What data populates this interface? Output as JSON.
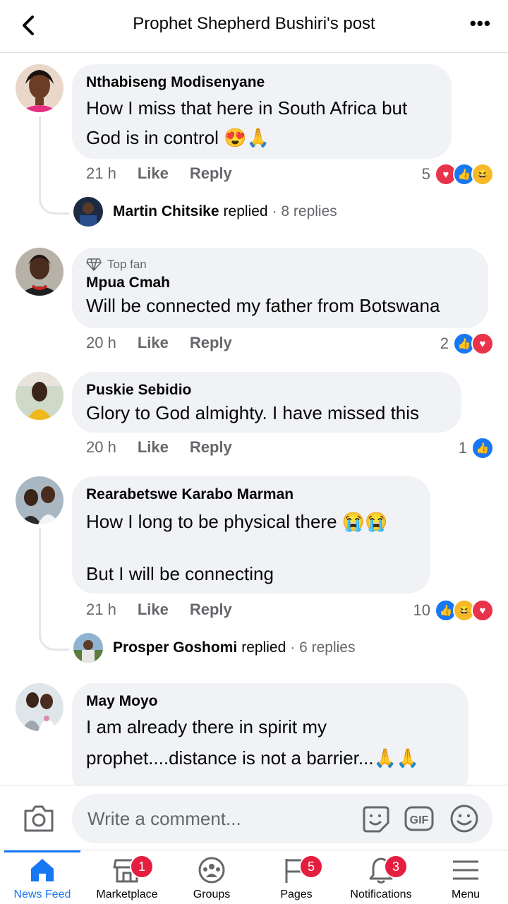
{
  "header": {
    "title": "Prophet Shepherd Bushiri's post"
  },
  "comments": [
    {
      "author": "Nthabiseng Modisenyane",
      "lines": [
        "How I miss that here in South Africa but",
        "God is in control 😍🙏"
      ],
      "time": "21 h",
      "like": "Like",
      "reply": "Reply",
      "reaction_count": "5",
      "reactions": [
        "love",
        "like",
        "haha"
      ],
      "replied_by": "Martin Chitsike",
      "replied_text": "replied",
      "replies": "· 8 replies"
    },
    {
      "badge": "Top fan",
      "author": "Mpua Cmah",
      "lines": [
        "Will be connected my father from Botswana"
      ],
      "time": "20 h",
      "like": "Like",
      "reply": "Reply",
      "reaction_count": "2",
      "reactions": [
        "like",
        "love"
      ]
    },
    {
      "author": "Puskie Sebidio",
      "lines": [
        "Glory to God almighty. I have missed this"
      ],
      "time": "20 h",
      "like": "Like",
      "reply": "Reply",
      "reaction_count": "1",
      "reactions": [
        "like"
      ]
    },
    {
      "author": "Rearabetswe Karabo Marman",
      "lines": [
        "How I long to be physical there 😭😭",
        "",
        "But I will be connecting"
      ],
      "time": "21 h",
      "like": "Like",
      "reply": "Reply",
      "reaction_count": "10",
      "reactions": [
        "like",
        "haha",
        "love"
      ],
      "replied_by": "Prosper Goshomi",
      "replied_text": "replied",
      "replies": "· 6 replies"
    },
    {
      "author": "May Moyo",
      "lines": [
        "I am already there in spirit my",
        "prophet....distance is not a barrier...🙏🙏"
      ]
    }
  ],
  "composer": {
    "placeholder": "Write a comment..."
  },
  "tabs": [
    {
      "label": "News Feed",
      "icon": "home-icon"
    },
    {
      "label": "Marketplace",
      "icon": "marketplace-icon",
      "badge": "1"
    },
    {
      "label": "Groups",
      "icon": "groups-icon"
    },
    {
      "label": "Pages",
      "icon": "pages-icon",
      "badge": "5"
    },
    {
      "label": "Notifications",
      "icon": "bell-icon",
      "badge": "3"
    },
    {
      "label": "Menu",
      "icon": "menu-icon"
    }
  ],
  "colors": {
    "accent": "#1877f2",
    "bubble": "#f0f2f5",
    "badge": "#e41e3f"
  }
}
